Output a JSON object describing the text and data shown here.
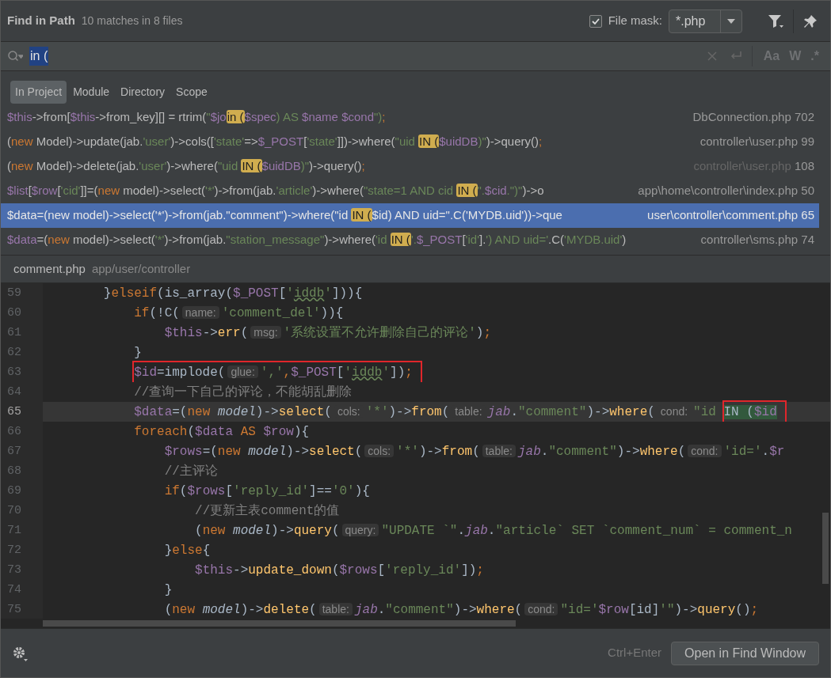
{
  "header": {
    "title": "Find in Path",
    "summary": "10 matches in 8 files",
    "file_mask": {
      "label": "File mask:",
      "checked": true,
      "value": "*.php"
    }
  },
  "search": {
    "value": "in (",
    "options": [
      "Aa",
      "W",
      ".*"
    ]
  },
  "scopes": [
    {
      "label": "In Project",
      "selected": true
    },
    {
      "label": "Module",
      "selected": false
    },
    {
      "label": "Directory",
      "selected": false
    },
    {
      "label": "Scope",
      "selected": false
    }
  ],
  "results": [
    {
      "selected": false,
      "path": "DbConnection.php",
      "path_dimmed": false,
      "line": "702",
      "code": [
        {
          "kind": "var",
          "text": "$this"
        },
        {
          "kind": "plain",
          "text": "->from["
        },
        {
          "kind": "var",
          "text": "$this"
        },
        {
          "kind": "plain",
          "text": "->from_key][] = rtrim("
        },
        {
          "kind": "str",
          "text": "\""
        },
        {
          "kind": "var",
          "text": "$jo"
        },
        {
          "kind": "match",
          "text": "in ("
        },
        {
          "kind": "var",
          "text": "$spec"
        },
        {
          "kind": "str",
          "text": ") AS "
        },
        {
          "kind": "var",
          "text": "$name "
        },
        {
          "kind": "var",
          "text": "$cond"
        },
        {
          "kind": "str",
          "text": "\")"
        },
        {
          "kind": "kw",
          "text": ";"
        }
      ]
    },
    {
      "selected": false,
      "path": "controller\\user.php",
      "path_dimmed": false,
      "line": "99",
      "code": [
        {
          "kind": "plain",
          "text": "("
        },
        {
          "kind": "kw",
          "text": "new"
        },
        {
          "kind": "plain",
          "text": " Model)->update(jab."
        },
        {
          "kind": "str",
          "text": "'user'"
        },
        {
          "kind": "plain",
          "text": ")->cols(["
        },
        {
          "kind": "str",
          "text": "'state'"
        },
        {
          "kind": "plain",
          "text": "=>"
        },
        {
          "kind": "var",
          "text": "$_POST"
        },
        {
          "kind": "plain",
          "text": "["
        },
        {
          "kind": "str",
          "text": "'state'"
        },
        {
          "kind": "plain",
          "text": "]])->where("
        },
        {
          "kind": "str",
          "text": "\"uid "
        },
        {
          "kind": "match",
          "text": "IN ("
        },
        {
          "kind": "var",
          "text": "$uidDB"
        },
        {
          "kind": "str",
          "text": ")\""
        },
        {
          "kind": "plain",
          "text": ")->query()"
        },
        {
          "kind": "kw",
          "text": ";"
        }
      ]
    },
    {
      "selected": false,
      "path": "controller\\user.php",
      "path_dimmed": true,
      "line": "108",
      "code": [
        {
          "kind": "plain",
          "text": "("
        },
        {
          "kind": "kw",
          "text": "new"
        },
        {
          "kind": "plain",
          "text": " Model)->delete(jab."
        },
        {
          "kind": "str",
          "text": "'user'"
        },
        {
          "kind": "plain",
          "text": ")->where("
        },
        {
          "kind": "str",
          "text": "\"uid "
        },
        {
          "kind": "match",
          "text": "IN ("
        },
        {
          "kind": "var",
          "text": "$uidDB"
        },
        {
          "kind": "str",
          "text": ")\""
        },
        {
          "kind": "plain",
          "text": ")->query()"
        },
        {
          "kind": "kw",
          "text": ";"
        }
      ]
    },
    {
      "selected": false,
      "path": "app\\home\\controller\\index.php",
      "path_dimmed": false,
      "line": "50",
      "code": [
        {
          "kind": "var",
          "text": "$list"
        },
        {
          "kind": "plain",
          "text": "["
        },
        {
          "kind": "var",
          "text": "$row"
        },
        {
          "kind": "plain",
          "text": "["
        },
        {
          "kind": "str",
          "text": "'cid'"
        },
        {
          "kind": "plain",
          "text": "]]=("
        },
        {
          "kind": "kw",
          "text": "new"
        },
        {
          "kind": "plain",
          "text": " model)->select("
        },
        {
          "kind": "str",
          "text": "'*'"
        },
        {
          "kind": "plain",
          "text": ")->from(jab."
        },
        {
          "kind": "str",
          "text": "'article'"
        },
        {
          "kind": "plain",
          "text": ")->where("
        },
        {
          "kind": "str",
          "text": "\"state=1 AND cid "
        },
        {
          "kind": "match",
          "text": "IN ("
        },
        {
          "kind": "str",
          "text": "\"."
        },
        {
          "kind": "var",
          "text": "$cid"
        },
        {
          "kind": "str",
          "text": ".\")\""
        },
        {
          "kind": "plain",
          "text": ")->o"
        }
      ]
    },
    {
      "selected": true,
      "path": "user\\controller\\comment.php",
      "path_dimmed": false,
      "line": "65",
      "code": [
        {
          "kind": "var",
          "text": "$data"
        },
        {
          "kind": "plain",
          "text": "=("
        },
        {
          "kind": "kw",
          "text": "new"
        },
        {
          "kind": "plain",
          "text": " model)->select("
        },
        {
          "kind": "str",
          "text": "'*'"
        },
        {
          "kind": "plain",
          "text": ")->from(jab."
        },
        {
          "kind": "str",
          "text": "\"comment\""
        },
        {
          "kind": "plain",
          "text": ")->where("
        },
        {
          "kind": "str",
          "text": "\"id "
        },
        {
          "kind": "match",
          "text": "IN ("
        },
        {
          "kind": "var",
          "text": "$id"
        },
        {
          "kind": "str",
          "text": ") AND uid=\""
        },
        {
          "kind": "plain",
          "text": ".C("
        },
        {
          "kind": "str",
          "text": "'MYDB.uid'"
        },
        {
          "kind": "plain",
          "text": "))->que"
        }
      ]
    },
    {
      "selected": false,
      "path": "controller\\sms.php",
      "path_dimmed": false,
      "line": "74",
      "code": [
        {
          "kind": "var",
          "text": "$data"
        },
        {
          "kind": "plain",
          "text": "=("
        },
        {
          "kind": "kw",
          "text": "new"
        },
        {
          "kind": "plain",
          "text": " model)->select("
        },
        {
          "kind": "str",
          "text": "'*'"
        },
        {
          "kind": "plain",
          "text": ")->from(jab."
        },
        {
          "kind": "str",
          "text": "\"station_message\""
        },
        {
          "kind": "plain",
          "text": ")->where("
        },
        {
          "kind": "str",
          "text": "'id "
        },
        {
          "kind": "match",
          "text": "IN ("
        },
        {
          "kind": "str",
          "text": "'."
        },
        {
          "kind": "var",
          "text": "$_POST"
        },
        {
          "kind": "plain",
          "text": "["
        },
        {
          "kind": "str",
          "text": "'id'"
        },
        {
          "kind": "plain",
          "text": "]."
        },
        {
          "kind": "str",
          "text": "') AND uid='"
        },
        {
          "kind": "plain",
          "text": ".C("
        },
        {
          "kind": "str",
          "text": "'MYDB.uid'"
        },
        {
          "kind": "plain",
          "text": ")"
        }
      ]
    }
  ],
  "preview": {
    "file": "comment.php",
    "path": "app/user/controller"
  },
  "editor_lines": [
    {
      "number": "59",
      "current": false,
      "tokens": [
        {
          "kind": "plain",
          "text": "        }"
        },
        {
          "kind": "kw",
          "text": "elseif"
        },
        {
          "kind": "plain",
          "text": "(is_array("
        },
        {
          "kind": "var",
          "text": "$_POST"
        },
        {
          "kind": "plain",
          "text": "["
        },
        {
          "kind": "str",
          "text": "'"
        },
        {
          "kind": "squiggle",
          "text": "iddb"
        },
        {
          "kind": "str",
          "text": "'"
        },
        {
          "kind": "plain",
          "text": "])){"
        }
      ]
    },
    {
      "number": "60",
      "current": false,
      "tokens": [
        {
          "kind": "kw",
          "text": "            if"
        },
        {
          "kind": "plain",
          "text": "(!C("
        },
        {
          "kind": "hint",
          "text": "name:"
        },
        {
          "kind": "str",
          "text": "'comment_del'"
        },
        {
          "kind": "plain",
          "text": ")){"
        }
      ]
    },
    {
      "number": "61",
      "current": false,
      "tokens": [
        {
          "kind": "var",
          "text": "                $this"
        },
        {
          "kind": "plain",
          "text": "->"
        },
        {
          "kind": "func",
          "text": "err"
        },
        {
          "kind": "plain",
          "text": "("
        },
        {
          "kind": "hint",
          "text": "msg:"
        },
        {
          "kind": "str",
          "text": "'系统设置不允许删除自己的评论'"
        },
        {
          "kind": "plain",
          "text": ")"
        },
        {
          "kind": "kw",
          "text": ";"
        }
      ]
    },
    {
      "number": "62",
      "current": false,
      "tokens": [
        {
          "kind": "plain",
          "text": "            }"
        }
      ]
    },
    {
      "number": "63",
      "current": false,
      "tokens": [
        {
          "kind": "var",
          "text": "$id",
          "boxed": true
        },
        {
          "kind": "plain",
          "text": "=implode(",
          "boxed": true
        },
        {
          "kind": "hint",
          "text": "glue:",
          "boxed": true
        },
        {
          "kind": "str",
          "text": "','",
          "boxed": true
        },
        {
          "kind": "kw",
          "text": ",",
          "boxed": true
        },
        {
          "kind": "var",
          "text": "$_POST",
          "boxed": true
        },
        {
          "kind": "plain",
          "text": "[",
          "boxed": true
        },
        {
          "kind": "str",
          "text": "'",
          "boxed": true
        },
        {
          "kind": "squiggle",
          "text": "iddb",
          "boxed": true
        },
        {
          "kind": "str",
          "text": "'",
          "boxed": true
        },
        {
          "kind": "plain",
          "text": "])",
          "boxed": true
        },
        {
          "kind": "kw",
          "text": ";",
          "boxed": true
        }
      ]
    },
    {
      "number": "64",
      "current": false,
      "tokens": [
        {
          "kind": "comment",
          "text": "            //查询一下自己的评论，不能胡乱删除"
        }
      ]
    },
    {
      "number": "65",
      "current": true,
      "tokens": [
        {
          "kind": "var",
          "text": "            $data"
        },
        {
          "kind": "plain",
          "text": "=("
        },
        {
          "kind": "kw",
          "text": "new"
        },
        {
          "kind": "italic",
          "text": " model"
        },
        {
          "kind": "plain",
          "text": ")->"
        },
        {
          "kind": "func",
          "text": "select"
        },
        {
          "kind": "plain",
          "text": "("
        },
        {
          "kind": "hint",
          "text": "cols:"
        },
        {
          "kind": "str",
          "text": "'*'"
        },
        {
          "kind": "plain",
          "text": ")->"
        },
        {
          "kind": "func",
          "text": "from"
        },
        {
          "kind": "plain",
          "text": "("
        },
        {
          "kind": "hint",
          "text": "table:"
        },
        {
          "kind": "ivar",
          "text": "jab"
        },
        {
          "kind": "plain",
          "text": "."
        },
        {
          "kind": "str",
          "text": "\"comment\""
        },
        {
          "kind": "plain",
          "text": ")->"
        },
        {
          "kind": "func",
          "text": "where"
        },
        {
          "kind": "plain",
          "text": "("
        },
        {
          "kind": "hint",
          "text": "cond:"
        },
        {
          "kind": "str",
          "text": "\"id "
        },
        {
          "kind": "match",
          "text": "IN (",
          "boxed": true
        },
        {
          "kind": "matchvar",
          "text": "$id",
          "boxed": true
        }
      ]
    },
    {
      "number": "66",
      "current": false,
      "tokens": [
        {
          "kind": "kw",
          "text": "            foreach"
        },
        {
          "kind": "plain",
          "text": "("
        },
        {
          "kind": "var",
          "text": "$data"
        },
        {
          "kind": "kw",
          "text": " AS"
        },
        {
          "kind": "var",
          "text": " $row"
        },
        {
          "kind": "plain",
          "text": "){"
        }
      ]
    },
    {
      "number": "67",
      "current": false,
      "tokens": [
        {
          "kind": "var",
          "text": "                $rows"
        },
        {
          "kind": "plain",
          "text": "=("
        },
        {
          "kind": "kw",
          "text": "new"
        },
        {
          "kind": "italic",
          "text": " model"
        },
        {
          "kind": "plain",
          "text": ")->"
        },
        {
          "kind": "func",
          "text": "select"
        },
        {
          "kind": "plain",
          "text": "("
        },
        {
          "kind": "hint",
          "text": "cols:"
        },
        {
          "kind": "str",
          "text": "'*'"
        },
        {
          "kind": "plain",
          "text": ")->"
        },
        {
          "kind": "func",
          "text": "from"
        },
        {
          "kind": "plain",
          "text": "("
        },
        {
          "kind": "hint",
          "text": "table:"
        },
        {
          "kind": "ivar",
          "text": "jab"
        },
        {
          "kind": "plain",
          "text": "."
        },
        {
          "kind": "str",
          "text": "\"comment\""
        },
        {
          "kind": "plain",
          "text": ")->"
        },
        {
          "kind": "func",
          "text": "where"
        },
        {
          "kind": "plain",
          "text": "("
        },
        {
          "kind": "hint",
          "text": "cond:"
        },
        {
          "kind": "str",
          "text": "'id='"
        },
        {
          "kind": "plain",
          "text": "."
        },
        {
          "kind": "var",
          "text": "$r"
        }
      ]
    },
    {
      "number": "68",
      "current": false,
      "tokens": [
        {
          "kind": "comment",
          "text": "                //主评论"
        }
      ]
    },
    {
      "number": "69",
      "current": false,
      "tokens": [
        {
          "kind": "kw",
          "text": "                if"
        },
        {
          "kind": "plain",
          "text": "("
        },
        {
          "kind": "var",
          "text": "$rows"
        },
        {
          "kind": "plain",
          "text": "["
        },
        {
          "kind": "str",
          "text": "'reply_id'"
        },
        {
          "kind": "plain",
          "text": "]=="
        },
        {
          "kind": "str",
          "text": "'0'"
        },
        {
          "kind": "plain",
          "text": "){"
        }
      ]
    },
    {
      "number": "70",
      "current": false,
      "tokens": [
        {
          "kind": "comment",
          "text": "                    //更新主表comment的值"
        }
      ]
    },
    {
      "number": "71",
      "current": false,
      "tokens": [
        {
          "kind": "plain",
          "text": "                    ("
        },
        {
          "kind": "kw",
          "text": "new"
        },
        {
          "kind": "italic",
          "text": " model"
        },
        {
          "kind": "plain",
          "text": ")->"
        },
        {
          "kind": "func",
          "text": "query"
        },
        {
          "kind": "plain",
          "text": "("
        },
        {
          "kind": "hint",
          "text": "query:"
        },
        {
          "kind": "str",
          "text": "\"UPDATE `\""
        },
        {
          "kind": "plain",
          "text": "."
        },
        {
          "kind": "ivar",
          "text": "jab"
        },
        {
          "kind": "plain",
          "text": "."
        },
        {
          "kind": "str",
          "text": "\"article` SET `comment_num` = comment_n"
        }
      ]
    },
    {
      "number": "72",
      "current": false,
      "tokens": [
        {
          "kind": "plain",
          "text": "                }"
        },
        {
          "kind": "kw",
          "text": "else"
        },
        {
          "kind": "plain",
          "text": "{"
        }
      ]
    },
    {
      "number": "73",
      "current": false,
      "tokens": [
        {
          "kind": "var",
          "text": "                    $this"
        },
        {
          "kind": "plain",
          "text": "->"
        },
        {
          "kind": "func",
          "text": "update_down"
        },
        {
          "kind": "plain",
          "text": "("
        },
        {
          "kind": "var",
          "text": "$rows"
        },
        {
          "kind": "plain",
          "text": "["
        },
        {
          "kind": "str",
          "text": "'reply_id'"
        },
        {
          "kind": "plain",
          "text": "])"
        },
        {
          "kind": "kw",
          "text": ";"
        }
      ]
    },
    {
      "number": "74",
      "current": false,
      "tokens": [
        {
          "kind": "plain",
          "text": "                }"
        }
      ]
    },
    {
      "number": "75",
      "current": false,
      "tokens": [
        {
          "kind": "plain",
          "text": "                ("
        },
        {
          "kind": "kw",
          "text": "new"
        },
        {
          "kind": "italic",
          "text": " model"
        },
        {
          "kind": "plain",
          "text": ")->"
        },
        {
          "kind": "func",
          "text": "delete"
        },
        {
          "kind": "plain",
          "text": "("
        },
        {
          "kind": "hint",
          "text": "table:"
        },
        {
          "kind": "ivar",
          "text": "jab"
        },
        {
          "kind": "plain",
          "text": "."
        },
        {
          "kind": "str",
          "text": "\"comment\""
        },
        {
          "kind": "plain",
          "text": ")->"
        },
        {
          "kind": "func",
          "text": "where"
        },
        {
          "kind": "plain",
          "text": "("
        },
        {
          "kind": "hint",
          "text": "cond:"
        },
        {
          "kind": "str",
          "text": "\"id='"
        },
        {
          "kind": "var",
          "text": "$row"
        },
        {
          "kind": "plain",
          "text": "[id]"
        },
        {
          "kind": "str",
          "text": "'\""
        },
        {
          "kind": "plain",
          "text": ")->"
        },
        {
          "kind": "func",
          "text": "query"
        },
        {
          "kind": "plain",
          "text": "()"
        },
        {
          "kind": "kw",
          "text": ";"
        }
      ]
    }
  ],
  "footer": {
    "shortcut": "Ctrl+Enter",
    "button": "Open in Find Window"
  }
}
